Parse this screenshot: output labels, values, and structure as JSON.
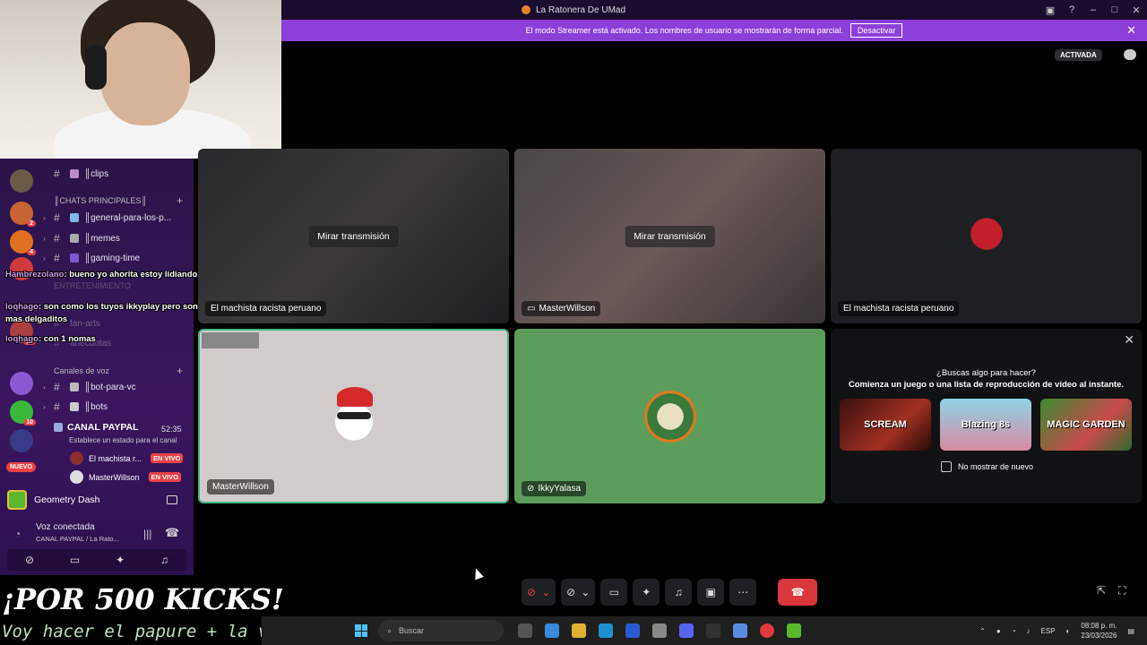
{
  "window": {
    "title": "La Ratonera De UMad"
  },
  "banner": {
    "text": "El modo Streamer está activado. Los nombres de usuario se mostrarán de forma parcial.",
    "button": "Desactivar",
    "close": "✕"
  },
  "header": {
    "activada": "ACTIVADA"
  },
  "sidebar": {
    "channels": [
      {
        "name": "clips",
        "label": "║clips"
      },
      {
        "name": "general",
        "label": "║general-para-los-p..."
      },
      {
        "name": "memes",
        "label": "║memes"
      },
      {
        "name": "gaming-time",
        "label": "║gaming-time"
      },
      {
        "name": "fan-arts",
        "label": "fan-arts"
      },
      {
        "name": "anecdotas",
        "label": "anecdotas"
      },
      {
        "name": "bot-para-vc",
        "label": "║bot-para-vc"
      },
      {
        "name": "bots",
        "label": "║bots"
      }
    ],
    "categories": {
      "chats": "║CHATS PRINCIPALES║",
      "entretenimiento": "ENTRETENIMIENTO",
      "voz": "Canales de voz"
    },
    "badges": [
      "2",
      "4",
      "2",
      "19",
      "10"
    ],
    "nuevo": "NUEVO",
    "voice_channel": {
      "name": "CANAL PAYPAL",
      "time": "52:35",
      "status": "Establece un estado para el canal",
      "users": [
        {
          "name": "El machista r...",
          "live": "EN VIVO"
        },
        {
          "name": "MasterWillson",
          "live": "EN VIVO"
        }
      ]
    },
    "activity": "Geometry Dash",
    "voice_connected": {
      "label": "Voz conectada",
      "sub": "CANAL PAYPAL / La Rato..."
    }
  },
  "chat": [
    {
      "user": "Hambrezolano",
      "text": "bueno yo ahorita estoy lidiando xon criar un gato"
    },
    {
      "user": "loqhago",
      "text": "son como los tuyos ikkyplay pero son un poco mas delgaditos"
    },
    {
      "user": "loqhago",
      "text": "con 1 nomas"
    }
  ],
  "tiles": {
    "t1": {
      "watch": "Mirar transmisión",
      "name": "El machista racista peruano"
    },
    "t2": {
      "watch": "Mirar transmisión",
      "name": "MasterWillson"
    },
    "t3": {
      "name": "El machista racista peruano"
    },
    "t4": {
      "name": "MasterWillson"
    },
    "t5": {
      "name": "IkkyYalasa"
    }
  },
  "activity_panel": {
    "q1": "¿Buscas algo para hacer?",
    "q2": "Comienza un juego o una lista de reproducción de video al instante.",
    "games": [
      "SCREAM",
      "Blazing 8s",
      "MAGIC GARDEN"
    ],
    "checkbox": "No mostrar de nuevo"
  },
  "overlay": {
    "title": "¡POR 500 KICKS!",
    "line": "Voy hacer el papure + la vaca lola"
  },
  "taskbar": {
    "search": "Buscar",
    "lang": "ESP",
    "time": "08:08 p. m.",
    "date": "23/03/2026"
  }
}
